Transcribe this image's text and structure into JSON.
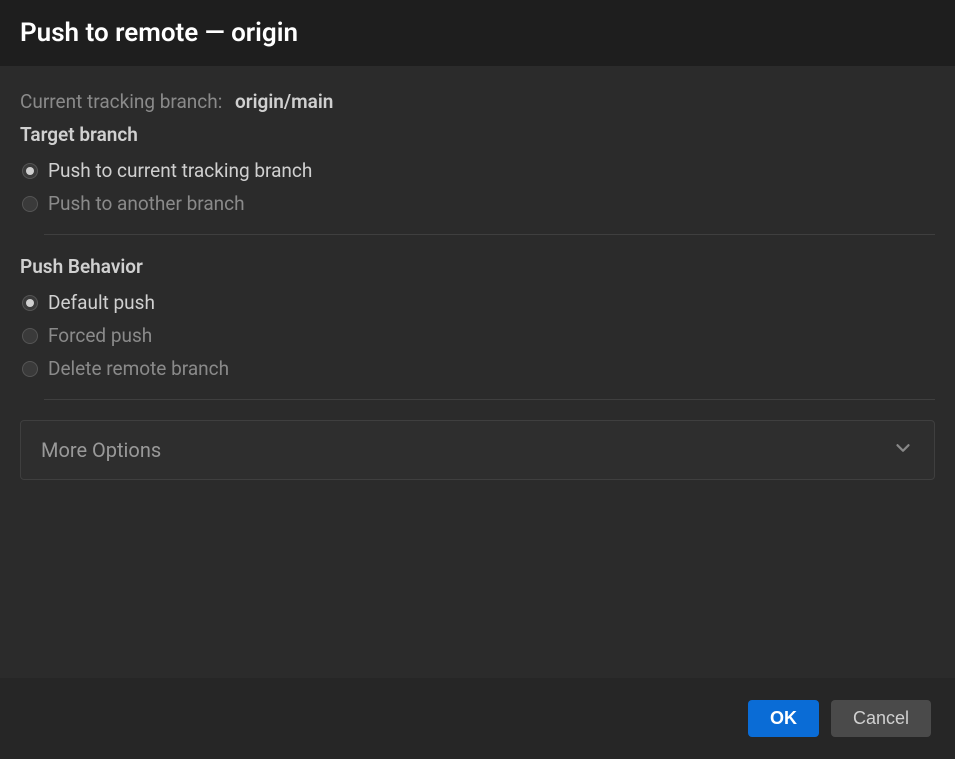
{
  "header": {
    "title": "Push to remote — origin"
  },
  "tracking": {
    "label": "Current tracking branch:",
    "value": "origin/main"
  },
  "target": {
    "label": "Target branch",
    "options": [
      "Push to current tracking branch",
      "Push to another branch"
    ]
  },
  "behavior": {
    "label": "Push Behavior",
    "options": [
      "Default push",
      "Forced push",
      "Delete remote branch"
    ]
  },
  "expander": {
    "label": "More Options"
  },
  "footer": {
    "ok": "OK",
    "cancel": "Cancel"
  }
}
